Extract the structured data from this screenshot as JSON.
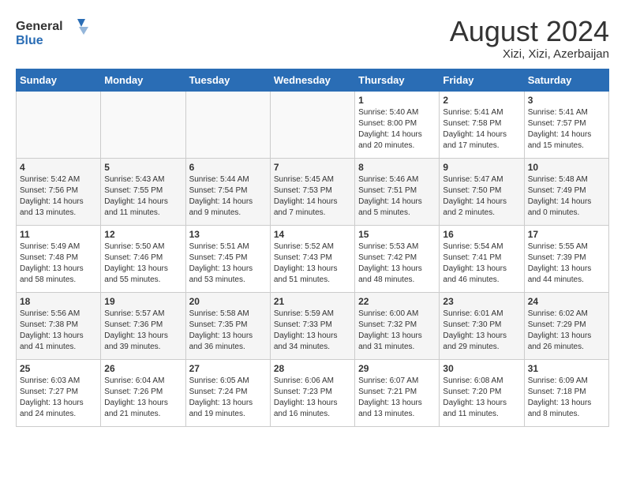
{
  "header": {
    "logo": {
      "general": "General",
      "blue": "Blue"
    },
    "month_title": "August 2024",
    "location": "Xizi, Xizi, Azerbaijan"
  },
  "days_of_week": [
    "Sunday",
    "Monday",
    "Tuesday",
    "Wednesday",
    "Thursday",
    "Friday",
    "Saturday"
  ],
  "weeks": [
    [
      {
        "day": "",
        "sunrise": "",
        "sunset": "",
        "daylight": ""
      },
      {
        "day": "",
        "sunrise": "",
        "sunset": "",
        "daylight": ""
      },
      {
        "day": "",
        "sunrise": "",
        "sunset": "",
        "daylight": ""
      },
      {
        "day": "",
        "sunrise": "",
        "sunset": "",
        "daylight": ""
      },
      {
        "day": "1",
        "sunrise": "Sunrise: 5:40 AM",
        "sunset": "Sunset: 8:00 PM",
        "daylight": "Daylight: 14 hours and 20 minutes."
      },
      {
        "day": "2",
        "sunrise": "Sunrise: 5:41 AM",
        "sunset": "Sunset: 7:58 PM",
        "daylight": "Daylight: 14 hours and 17 minutes."
      },
      {
        "day": "3",
        "sunrise": "Sunrise: 5:41 AM",
        "sunset": "Sunset: 7:57 PM",
        "daylight": "Daylight: 14 hours and 15 minutes."
      }
    ],
    [
      {
        "day": "4",
        "sunrise": "Sunrise: 5:42 AM",
        "sunset": "Sunset: 7:56 PM",
        "daylight": "Daylight: 14 hours and 13 minutes."
      },
      {
        "day": "5",
        "sunrise": "Sunrise: 5:43 AM",
        "sunset": "Sunset: 7:55 PM",
        "daylight": "Daylight: 14 hours and 11 minutes."
      },
      {
        "day": "6",
        "sunrise": "Sunrise: 5:44 AM",
        "sunset": "Sunset: 7:54 PM",
        "daylight": "Daylight: 14 hours and 9 minutes."
      },
      {
        "day": "7",
        "sunrise": "Sunrise: 5:45 AM",
        "sunset": "Sunset: 7:53 PM",
        "daylight": "Daylight: 14 hours and 7 minutes."
      },
      {
        "day": "8",
        "sunrise": "Sunrise: 5:46 AM",
        "sunset": "Sunset: 7:51 PM",
        "daylight": "Daylight: 14 hours and 5 minutes."
      },
      {
        "day": "9",
        "sunrise": "Sunrise: 5:47 AM",
        "sunset": "Sunset: 7:50 PM",
        "daylight": "Daylight: 14 hours and 2 minutes."
      },
      {
        "day": "10",
        "sunrise": "Sunrise: 5:48 AM",
        "sunset": "Sunset: 7:49 PM",
        "daylight": "Daylight: 14 hours and 0 minutes."
      }
    ],
    [
      {
        "day": "11",
        "sunrise": "Sunrise: 5:49 AM",
        "sunset": "Sunset: 7:48 PM",
        "daylight": "Daylight: 13 hours and 58 minutes."
      },
      {
        "day": "12",
        "sunrise": "Sunrise: 5:50 AM",
        "sunset": "Sunset: 7:46 PM",
        "daylight": "Daylight: 13 hours and 55 minutes."
      },
      {
        "day": "13",
        "sunrise": "Sunrise: 5:51 AM",
        "sunset": "Sunset: 7:45 PM",
        "daylight": "Daylight: 13 hours and 53 minutes."
      },
      {
        "day": "14",
        "sunrise": "Sunrise: 5:52 AM",
        "sunset": "Sunset: 7:43 PM",
        "daylight": "Daylight: 13 hours and 51 minutes."
      },
      {
        "day": "15",
        "sunrise": "Sunrise: 5:53 AM",
        "sunset": "Sunset: 7:42 PM",
        "daylight": "Daylight: 13 hours and 48 minutes."
      },
      {
        "day": "16",
        "sunrise": "Sunrise: 5:54 AM",
        "sunset": "Sunset: 7:41 PM",
        "daylight": "Daylight: 13 hours and 46 minutes."
      },
      {
        "day": "17",
        "sunrise": "Sunrise: 5:55 AM",
        "sunset": "Sunset: 7:39 PM",
        "daylight": "Daylight: 13 hours and 44 minutes."
      }
    ],
    [
      {
        "day": "18",
        "sunrise": "Sunrise: 5:56 AM",
        "sunset": "Sunset: 7:38 PM",
        "daylight": "Daylight: 13 hours and 41 minutes."
      },
      {
        "day": "19",
        "sunrise": "Sunrise: 5:57 AM",
        "sunset": "Sunset: 7:36 PM",
        "daylight": "Daylight: 13 hours and 39 minutes."
      },
      {
        "day": "20",
        "sunrise": "Sunrise: 5:58 AM",
        "sunset": "Sunset: 7:35 PM",
        "daylight": "Daylight: 13 hours and 36 minutes."
      },
      {
        "day": "21",
        "sunrise": "Sunrise: 5:59 AM",
        "sunset": "Sunset: 7:33 PM",
        "daylight": "Daylight: 13 hours and 34 minutes."
      },
      {
        "day": "22",
        "sunrise": "Sunrise: 6:00 AM",
        "sunset": "Sunset: 7:32 PM",
        "daylight": "Daylight: 13 hours and 31 minutes."
      },
      {
        "day": "23",
        "sunrise": "Sunrise: 6:01 AM",
        "sunset": "Sunset: 7:30 PM",
        "daylight": "Daylight: 13 hours and 29 minutes."
      },
      {
        "day": "24",
        "sunrise": "Sunrise: 6:02 AM",
        "sunset": "Sunset: 7:29 PM",
        "daylight": "Daylight: 13 hours and 26 minutes."
      }
    ],
    [
      {
        "day": "25",
        "sunrise": "Sunrise: 6:03 AM",
        "sunset": "Sunset: 7:27 PM",
        "daylight": "Daylight: 13 hours and 24 minutes."
      },
      {
        "day": "26",
        "sunrise": "Sunrise: 6:04 AM",
        "sunset": "Sunset: 7:26 PM",
        "daylight": "Daylight: 13 hours and 21 minutes."
      },
      {
        "day": "27",
        "sunrise": "Sunrise: 6:05 AM",
        "sunset": "Sunset: 7:24 PM",
        "daylight": "Daylight: 13 hours and 19 minutes."
      },
      {
        "day": "28",
        "sunrise": "Sunrise: 6:06 AM",
        "sunset": "Sunset: 7:23 PM",
        "daylight": "Daylight: 13 hours and 16 minutes."
      },
      {
        "day": "29",
        "sunrise": "Sunrise: 6:07 AM",
        "sunset": "Sunset: 7:21 PM",
        "daylight": "Daylight: 13 hours and 13 minutes."
      },
      {
        "day": "30",
        "sunrise": "Sunrise: 6:08 AM",
        "sunset": "Sunset: 7:20 PM",
        "daylight": "Daylight: 13 hours and 11 minutes."
      },
      {
        "day": "31",
        "sunrise": "Sunrise: 6:09 AM",
        "sunset": "Sunset: 7:18 PM",
        "daylight": "Daylight: 13 hours and 8 minutes."
      }
    ]
  ]
}
